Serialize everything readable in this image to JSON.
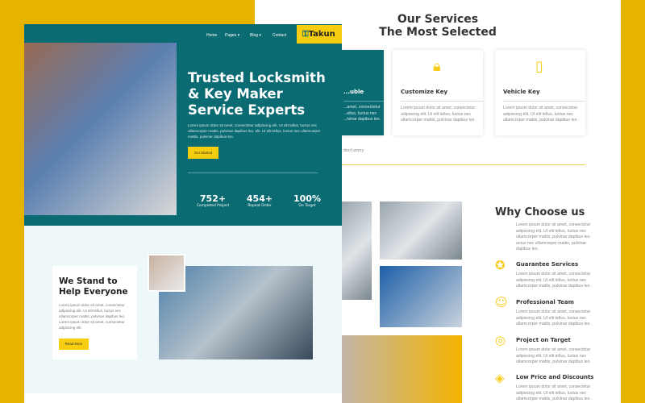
{
  "colors": {
    "teal": "#0b6b72",
    "yellow": "#f7cd0f",
    "background": "#e6b400"
  },
  "services": {
    "title_line1": "Our Services",
    "title_line2": "The Most Selected",
    "cards": [
      {
        "title": "...uble",
        "text": "...amet, consectetur ...ellus, luctus nec ...lvinar dapibus leo.",
        "icon": "lock-icon"
      },
      {
        "title": "Customize Key",
        "text": "Lorem ipsum dolor sit amet, consectetur adipiscing elit. Ut elit tellus, luctus nec ullamcorper mattis, pulvinar dapibus leo.",
        "icon": "padlock-icon"
      },
      {
        "title": "Vehicle Key",
        "text": "Lorem ipsum dolor sit amet, consectetur adipiscing elit. Ut elit tellus, luctus nec ullamcorper mattis, pulvinar dapibus leo.",
        "icon": "car-key-icon"
      }
    ],
    "note": "don't worry"
  },
  "why": {
    "title": "Why Choose us",
    "text": "Lorem ipsum dolor sit amet, consectetur adipiscing elit. Ut elit tellus, luctus nec ullamcorper mattis, pulvinar dapibus leo. uctus nec ullamcorper mattis, pulvinar dapibus leo.",
    "items": [
      {
        "title": "Guarantee Services",
        "text": "Lorem ipsum dolor sit amet, consectetur adipiscing elit. Ut elit tellus, luctus nec ullamcorper mattis, pulvinar dapibus leo.",
        "icon": "badge-icon"
      },
      {
        "title": "Professional Team",
        "text": "Lorem ipsum dolor sit amet, consectetur adipiscing elit. Ut elit tellus, luctus nec ullamcorper mattis, pulvinar dapibus leo.",
        "icon": "team-icon"
      },
      {
        "title": "Project on Target",
        "text": "Lorem ipsum dolor sit amet, consectetur adipiscing elit. Ut elit tellus, luctus nec ullamcorper mattis, pulvinar dapibus leo.",
        "icon": "target-icon"
      },
      {
        "title": "Low Price and Discounts",
        "text": "Lorem ipsum dolor sit amet, consectetur adipiscing elit. Ut elit tellus, luctus nec ullamcorper mattis, pulvinar dapibus leo.",
        "icon": "tag-icon"
      }
    ]
  },
  "nav": {
    "items": [
      "Home",
      "Pages ▾",
      "Blog ▾",
      "Contact"
    ],
    "logo": "Takun"
  },
  "hero": {
    "title": "Trusted Locksmith & Key Maker Service Experts",
    "text": "Lorem ipsum dolor sit amet, consectetur adipiscing elit. Ut elit tellus, luctus nec ullamcorper mattis, pulvinar dapibus leo.  elit. Ut elit tellus, luctus nec ullamcorper mattis, pulvinar dapibus leo.",
    "cta": "Get Started",
    "stats": [
      {
        "value": "752+",
        "label": "Completed Project"
      },
      {
        "value": "454+",
        "label": "Repeat Order"
      },
      {
        "value": "100%",
        "label": "On Target"
      }
    ]
  },
  "stand": {
    "title": "We Stand to Help Everyone",
    "text": "Lorem ipsum dolor sit amet, consectetur adipiscing elit. Ut elit tellus, luctus nec ullamcorper mattis, pulvinar dapibus leo. Lorem ipsum dolor sit amet, consectetur adipiscing elit.",
    "cta": "Read More"
  }
}
